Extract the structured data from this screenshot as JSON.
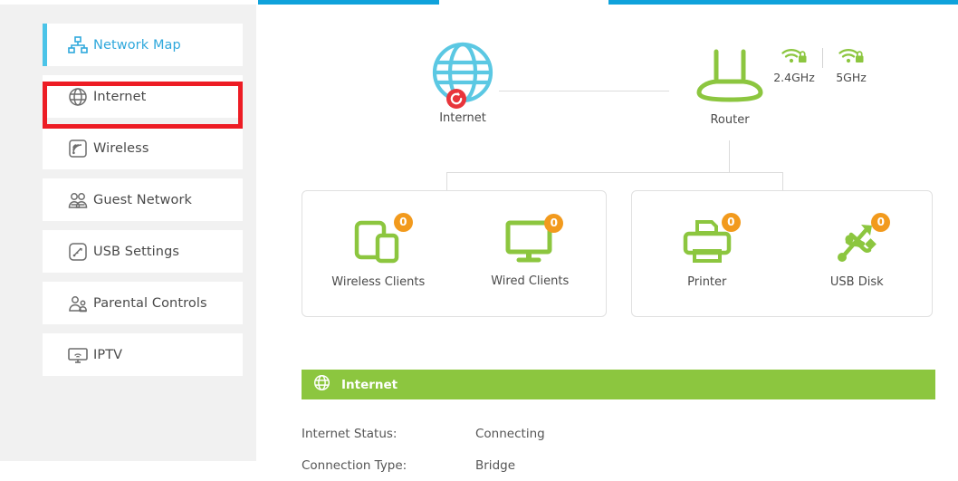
{
  "topbar": {
    "accent_color": "#0FA2DB"
  },
  "sidebar": {
    "items": [
      {
        "label": "Network Map",
        "icon": "network-map-icon",
        "active": true
      },
      {
        "label": "Internet",
        "icon": "globe-icon",
        "active": false
      },
      {
        "label": "Wireless",
        "icon": "wireless-signal-icon",
        "active": false
      },
      {
        "label": "Guest Network",
        "icon": "guest-users-icon",
        "active": false
      },
      {
        "label": "USB Settings",
        "icon": "usb-settings-icon",
        "active": false
      },
      {
        "label": "Parental Controls",
        "icon": "parental-controls-icon",
        "active": false
      },
      {
        "label": "IPTV",
        "icon": "iptv-monitor-icon",
        "active": false
      }
    ],
    "highlight": {
      "target": "Internet",
      "color": "#ED1C24"
    }
  },
  "topology": {
    "internet": {
      "caption": "Internet",
      "status_badge": "connecting-badge",
      "color": "#5BC8E3"
    },
    "router": {
      "caption": "Router",
      "color": "#8CC63F"
    },
    "wifi": [
      {
        "band": "2.4GHz",
        "secured": true
      },
      {
        "band": "5GHz",
        "secured": true
      }
    ]
  },
  "clients": {
    "left_card": [
      {
        "name": "Wireless Clients",
        "count": "0",
        "icon": "tablet-phone-icon"
      },
      {
        "name": "Wired Clients",
        "count": "0",
        "icon": "monitor-icon"
      }
    ],
    "right_card": [
      {
        "name": "Printer",
        "count": "0",
        "icon": "printer-icon"
      },
      {
        "name": "USB Disk",
        "count": "0",
        "icon": "usb-icon"
      }
    ],
    "badge_color": "#F29A1D"
  },
  "internet_panel": {
    "title": "Internet",
    "header_color": "#8CC63F",
    "rows": [
      {
        "label": "Internet Status:",
        "value": "Connecting"
      },
      {
        "label": "Connection Type:",
        "value": "Bridge"
      }
    ]
  }
}
